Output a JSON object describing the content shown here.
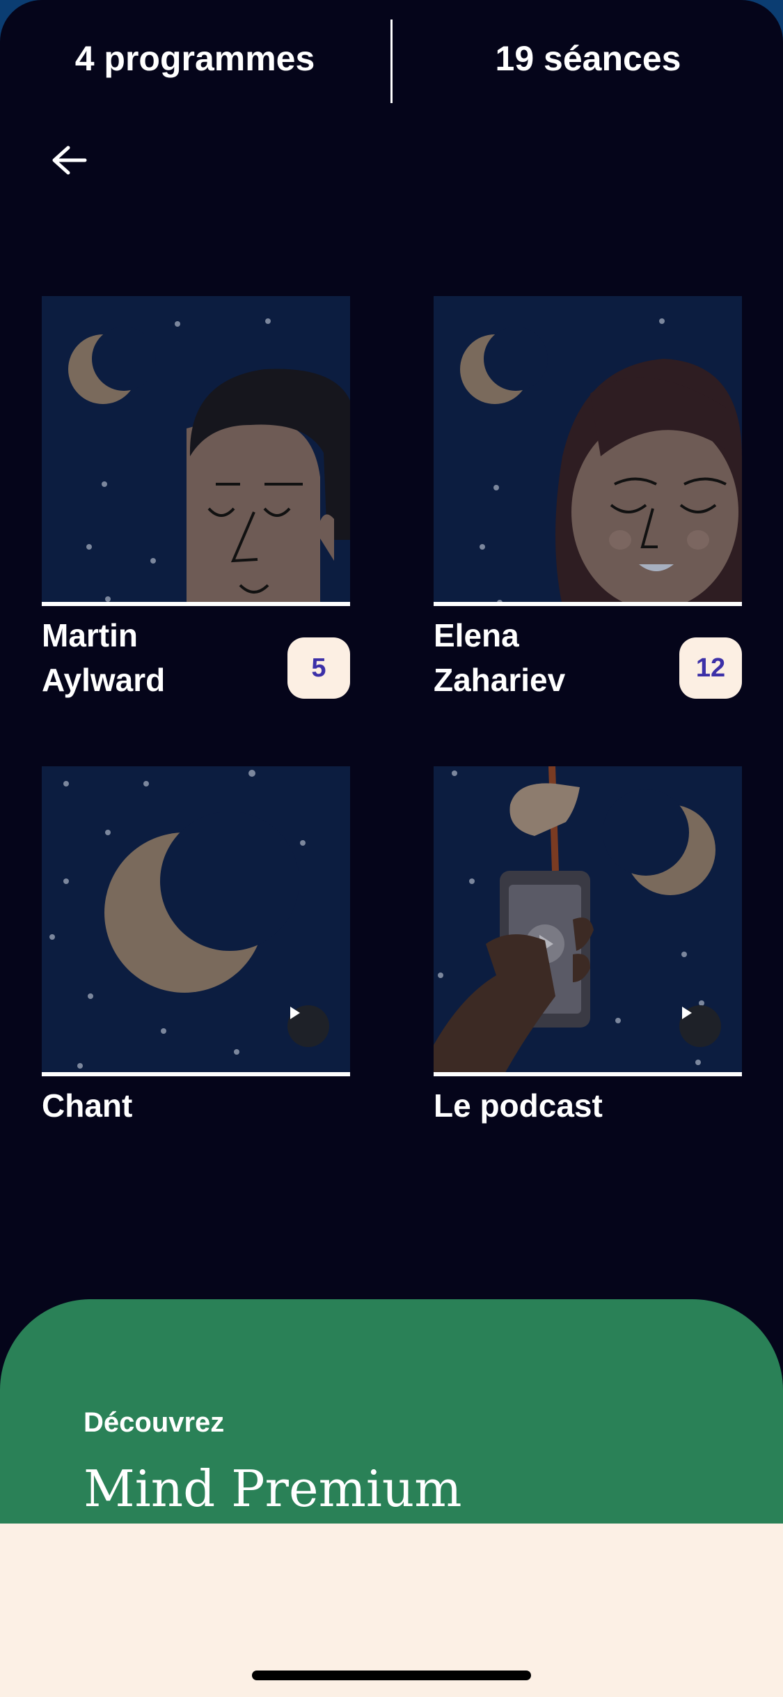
{
  "stats": {
    "programs": "4 programmes",
    "sessions": "19 séances"
  },
  "navigation": {
    "back_icon": "arrow-left-icon"
  },
  "cards": [
    {
      "title": "Martin Aylward",
      "count": "5",
      "kind": "program"
    },
    {
      "title": "Elena Zahariev",
      "count": "12",
      "kind": "program"
    },
    {
      "title": "Chant",
      "kind": "audio",
      "icon": "play-icon"
    },
    {
      "title": "Le podcast",
      "kind": "audio",
      "icon": "play-icon"
    }
  ],
  "premium": {
    "kicker": "Découvrez",
    "title": "Mind Premium"
  },
  "colors": {
    "background": "#05051a",
    "card_background": "#0c1d40",
    "moon": "#7a6a5c",
    "badge_background": "#fcefe3",
    "badge_text": "#3c30a8",
    "premium_green": "#2a8157",
    "sheet_cream": "#fcf0e5"
  }
}
